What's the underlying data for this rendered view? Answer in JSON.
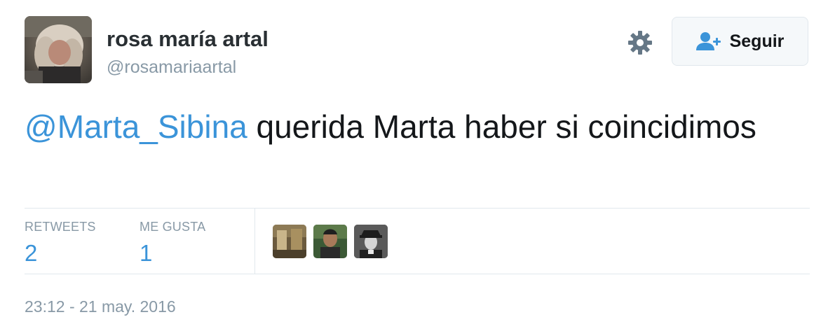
{
  "user": {
    "display_name": "rosa maría artal",
    "handle": "@rosamariaartal"
  },
  "actions": {
    "follow_label": "Seguir"
  },
  "tweet": {
    "mention": "@Marta_Sibina",
    "text_after_mention": " querida Marta haber si coincidimos"
  },
  "stats": {
    "retweets_label": "RETWEETS",
    "retweets_value": "2",
    "likes_label": "ME GUSTA",
    "likes_value": "1"
  },
  "liker_count_shown": 3,
  "timestamp": "23:12 - 21 may. 2016",
  "colors": {
    "link": "#3b94d9",
    "muted": "#8899a6",
    "text": "#14171a",
    "border": "#e1e8ed",
    "button_bg": "#f5f8fa"
  },
  "icons": {
    "settings": "gear-icon",
    "follow": "follow-user-plus-icon"
  }
}
